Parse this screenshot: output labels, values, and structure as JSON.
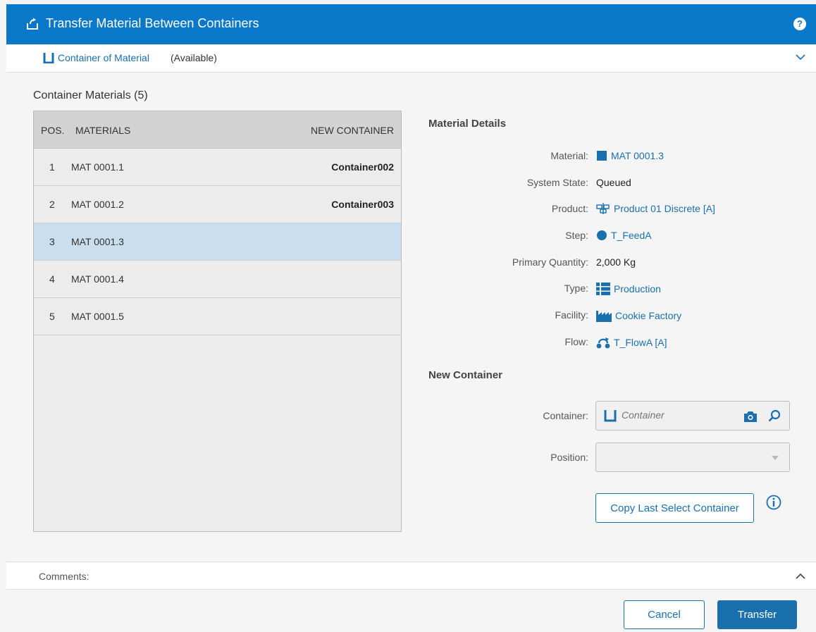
{
  "window": {
    "title": "Transfer Material Between Containers",
    "help_label": "?"
  },
  "breadcrumb": {
    "link": "Container of Material",
    "state": "(Available)"
  },
  "table": {
    "title": "Container Materials (5)",
    "headers": {
      "pos": "POS.",
      "materials": "MATERIALS",
      "new_container": "NEW CONTAINER"
    },
    "rows": [
      {
        "pos": "1",
        "material": "MAT 0001.1",
        "new_container": "Container002",
        "selected": false
      },
      {
        "pos": "2",
        "material": "MAT 0001.2",
        "new_container": "Container003",
        "selected": false
      },
      {
        "pos": "3",
        "material": "MAT 0001.3",
        "new_container": "",
        "selected": true
      },
      {
        "pos": "4",
        "material": "MAT 0001.4",
        "new_container": "",
        "selected": false
      },
      {
        "pos": "5",
        "material": "MAT 0001.5",
        "new_container": "",
        "selected": false
      }
    ]
  },
  "details": {
    "title": "Material Details",
    "material": {
      "label": "Material:",
      "value": "MAT 0001.3",
      "icon": "material-icon"
    },
    "system_state": {
      "label": "System State:",
      "value": "Queued"
    },
    "product": {
      "label": "Product:",
      "value": "Product 01 Discrete [A]",
      "icon": "product-icon"
    },
    "step": {
      "label": "Step:",
      "value": "T_FeedA",
      "icon": "step-icon"
    },
    "primary_quantity": {
      "label": "Primary Quantity:",
      "value": "2,000 Kg"
    },
    "type": {
      "label": "Type:",
      "value": "Production",
      "icon": "type-list-icon"
    },
    "facility": {
      "label": "Facility:",
      "value": "Cookie Factory",
      "icon": "factory-icon"
    },
    "flow": {
      "label": "Flow:",
      "value": "T_FlowA [A]",
      "icon": "flow-icon"
    }
  },
  "new_container": {
    "title": "New Container",
    "container_label": "Container:",
    "container_placeholder": "Container",
    "container_value": "",
    "position_label": "Position:",
    "position_value": "",
    "copy_button": "Copy Last Select Container"
  },
  "comments": {
    "label": "Comments:"
  },
  "footer": {
    "cancel": "Cancel",
    "transfer": "Transfer"
  },
  "colors": {
    "accent": "#0a78c8",
    "link": "#1a6fad",
    "selected_row": "#c9dff0"
  }
}
